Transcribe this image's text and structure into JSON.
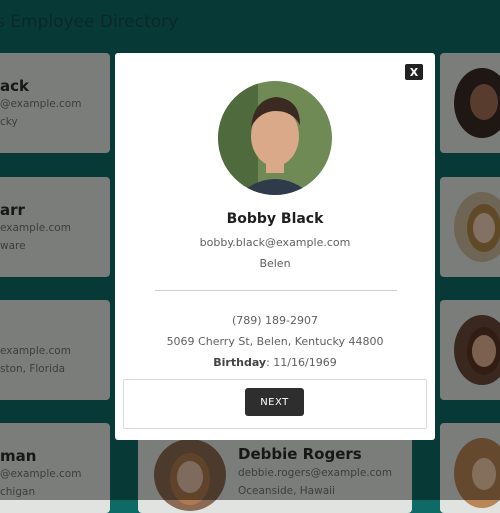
{
  "page": {
    "title": "s Employee Directory"
  },
  "cards": [
    {
      "name": "ack",
      "email": "@example.com",
      "location": "cky"
    },
    {
      "name": "arr",
      "email": "example.com",
      "location": "ware"
    },
    {
      "name": "",
      "email": "example.com",
      "location": "ston, Florida"
    },
    {
      "name": "man",
      "email": "@example.com",
      "location": "chigan"
    },
    {
      "name": "Debbie Rogers",
      "email": "debbie.rogers@example.com",
      "location": "Oceanside, Hawaii"
    }
  ],
  "modal": {
    "close_label": "X",
    "name": "Bobby Black",
    "email": "bobby.black@example.com",
    "city": "Belen",
    "phone": "(789) 189-2907",
    "address": "5069 Cherry St, Belen, Kentucky 44800",
    "birthday_label": "Birthday",
    "birthday_value": ": 11/16/1969",
    "next_label": "NEXT"
  }
}
